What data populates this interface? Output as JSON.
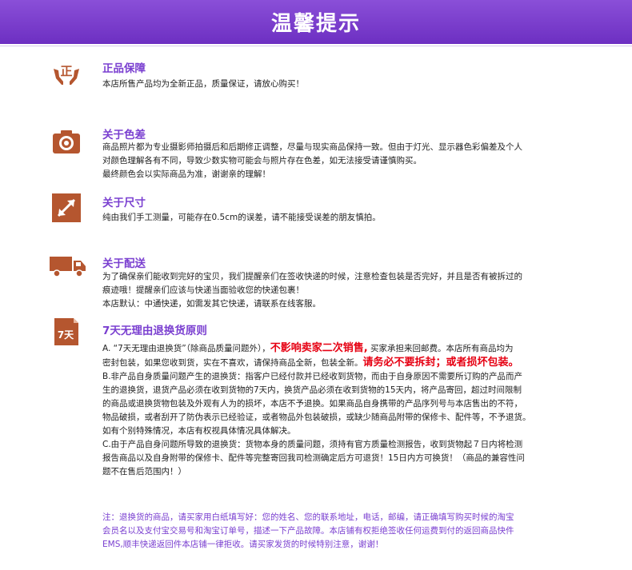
{
  "banner": {
    "title": "温馨提示"
  },
  "sections": {
    "genuine": {
      "icon": "genuine-hands-icon",
      "icon_text": "正",
      "title": "正品保障",
      "lines": [
        "本店所售产品均为全新正品，质量保证，请放心购买！"
      ]
    },
    "color": {
      "icon": "camera-icon",
      "title": "关于色差",
      "lines": [
        "商品照片都为专业摄影师拍摄后和后期修正调整，尽量与现实商品保持一致。但由于灯光、显示器色彩偏差及个人",
        "对颜色理解各有不同，导致少数实物可能会与照片存在色差，如无法接受请谨慎购买。",
        "最终颜色会以实际商品为准，谢谢亲的理解！"
      ]
    },
    "size": {
      "icon": "resize-arrow-icon",
      "title": "关于尺寸",
      "lines": [
        "纯由我们手工测量，可能存在0.5cm的误差，请不能接受误差的朋友慎拍。"
      ]
    },
    "delivery": {
      "icon": "truck-icon",
      "title": "关于配送",
      "lines": [
        "为了确保亲们能收到完好的宝贝，我们提醒亲们在签收快递的时候，注意检查包装是否完好，并且是否有被拆过的",
        "痕迹哦！提醒亲们应该与快递当面验收您的快递包裹！",
        "本店默认：中通快递，如需发其它快递，请联系在线客服。"
      ]
    },
    "returns": {
      "icon": "seven-day-calendar-icon",
      "icon_text": "7天",
      "title": "7天无理由退换货原则",
      "a_line1_pre": "A. “7天无理由退换货”（除商品质量问题外），",
      "a_line1_red": "不影响卖家二次销售,",
      "a_line1_post": " 买家承担来回邮费。本店所有商品均为",
      "a_line2_pre": "密封包装，如果您收到货，实在不喜欢，请保持商品全新，包装全新。",
      "a_line2_red": "请务必不要拆封；或者损坏包装。",
      "b_lines": [
        "B.非产品自身质量问题产生的退换货：指客户已经付款并已经收到货物，而由于自身原因不需要所订购的产品而产",
        "生的退换货，退货产品必须在收到货物的7天内，换货产品必须在收到货物的15天内，将产品寄回，超过时间限制",
        "的商品或退换货物包装及外观有人为的损坏，本店不予退换。如果商品自身携带的产品序列号与本店售出的不符，",
        "物品破损，或者刮开了防伪表示已经验证，或者物品外包装破损，或缺少随商品附带的保修卡、配件等，不予退货。",
        "如有个别特殊情况，本店有权视具体情况具体解决。"
      ],
      "c_lines": [
        "C.由于产品自身问题所导致的退换货：货物本身的质量问题，须持有官方质量检测报告，收到货物起７日内将检测",
        "报告商品以及自身附带的保修卡、配件等完整寄回我司检测确定后方可退货！15日内方可换货！（商品的兼容性问",
        "题不在售后范围内！）"
      ]
    }
  },
  "note": {
    "lines": [
      "注：退换货的商品，请买家用白纸填写好：您的姓名、您的联系地址，电话，邮编，请正确填写购买时候的淘宝",
      "会员名以及支付宝交易号和淘宝订单号，描述一下产品故障。本店铺有权拒绝签收任何运费到付的返回商品快件",
      "EMS,顺丰快递返回件本店铺一律拒收。请买家发货的时候特别注意，谢谢！"
    ]
  },
  "colors": {
    "accent": "#7a3fd0",
    "banner": "#6d2fc2",
    "icon": "#b5562f",
    "warning": "#e60012"
  }
}
